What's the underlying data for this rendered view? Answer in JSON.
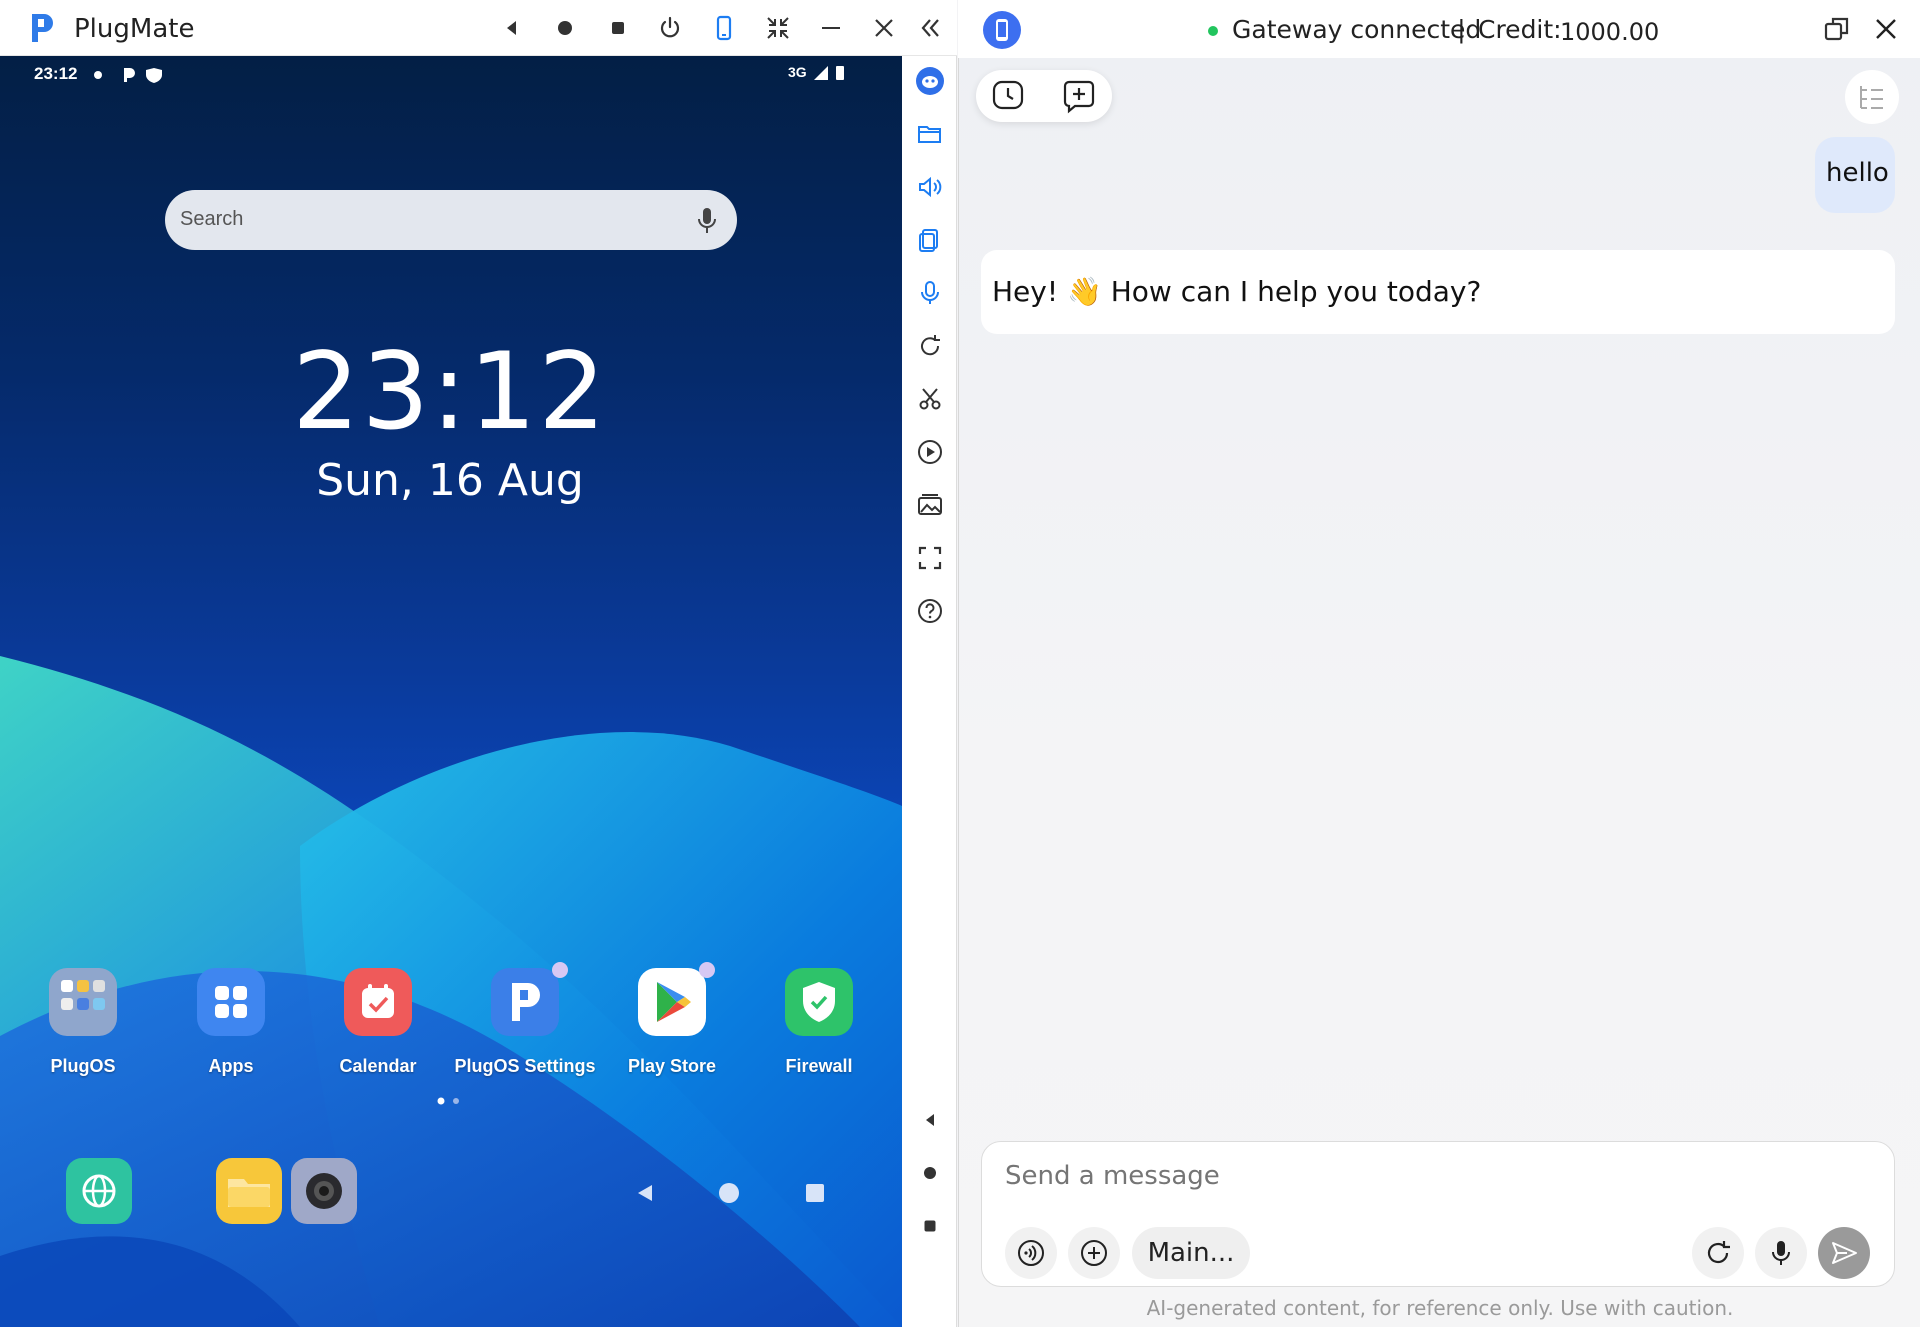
{
  "window": {
    "title": "PlugMate"
  },
  "phone": {
    "status_time": "23:12",
    "status_network": "3G",
    "search_placeholder": "Search",
    "clock": "23:12",
    "date": "Sun, 16 Aug",
    "apps": [
      {
        "label": "PlugOS",
        "icon": "folder-icon"
      },
      {
        "label": "Apps",
        "icon": "apps-grid-icon"
      },
      {
        "label": "Calendar",
        "icon": "calendar-icon"
      },
      {
        "label": "PlugOS Settings",
        "icon": "plugos-settings-icon"
      },
      {
        "label": "Play Store",
        "icon": "play-store-icon"
      },
      {
        "label": "Firewall",
        "icon": "firewall-icon"
      }
    ],
    "dock": [
      {
        "icon": "browser-icon"
      },
      {
        "icon": "files-icon"
      },
      {
        "icon": "camera-icon"
      }
    ]
  },
  "chat": {
    "gateway_status": "Gateway connected",
    "separator": "|",
    "credit_label": "Credit:",
    "credit_value": "1000.00",
    "user_message": "hello",
    "bot_message": "Hey! 👋 How can I help you today?",
    "composer_placeholder": "Send a message",
    "model_label": "Main...",
    "disclaimer": "AI-generated content, for reference only. Use with caution."
  },
  "colors": {
    "accent": "#1d7df2",
    "status_green": "#22c55e",
    "user_bubble": "#dfe9fb"
  }
}
